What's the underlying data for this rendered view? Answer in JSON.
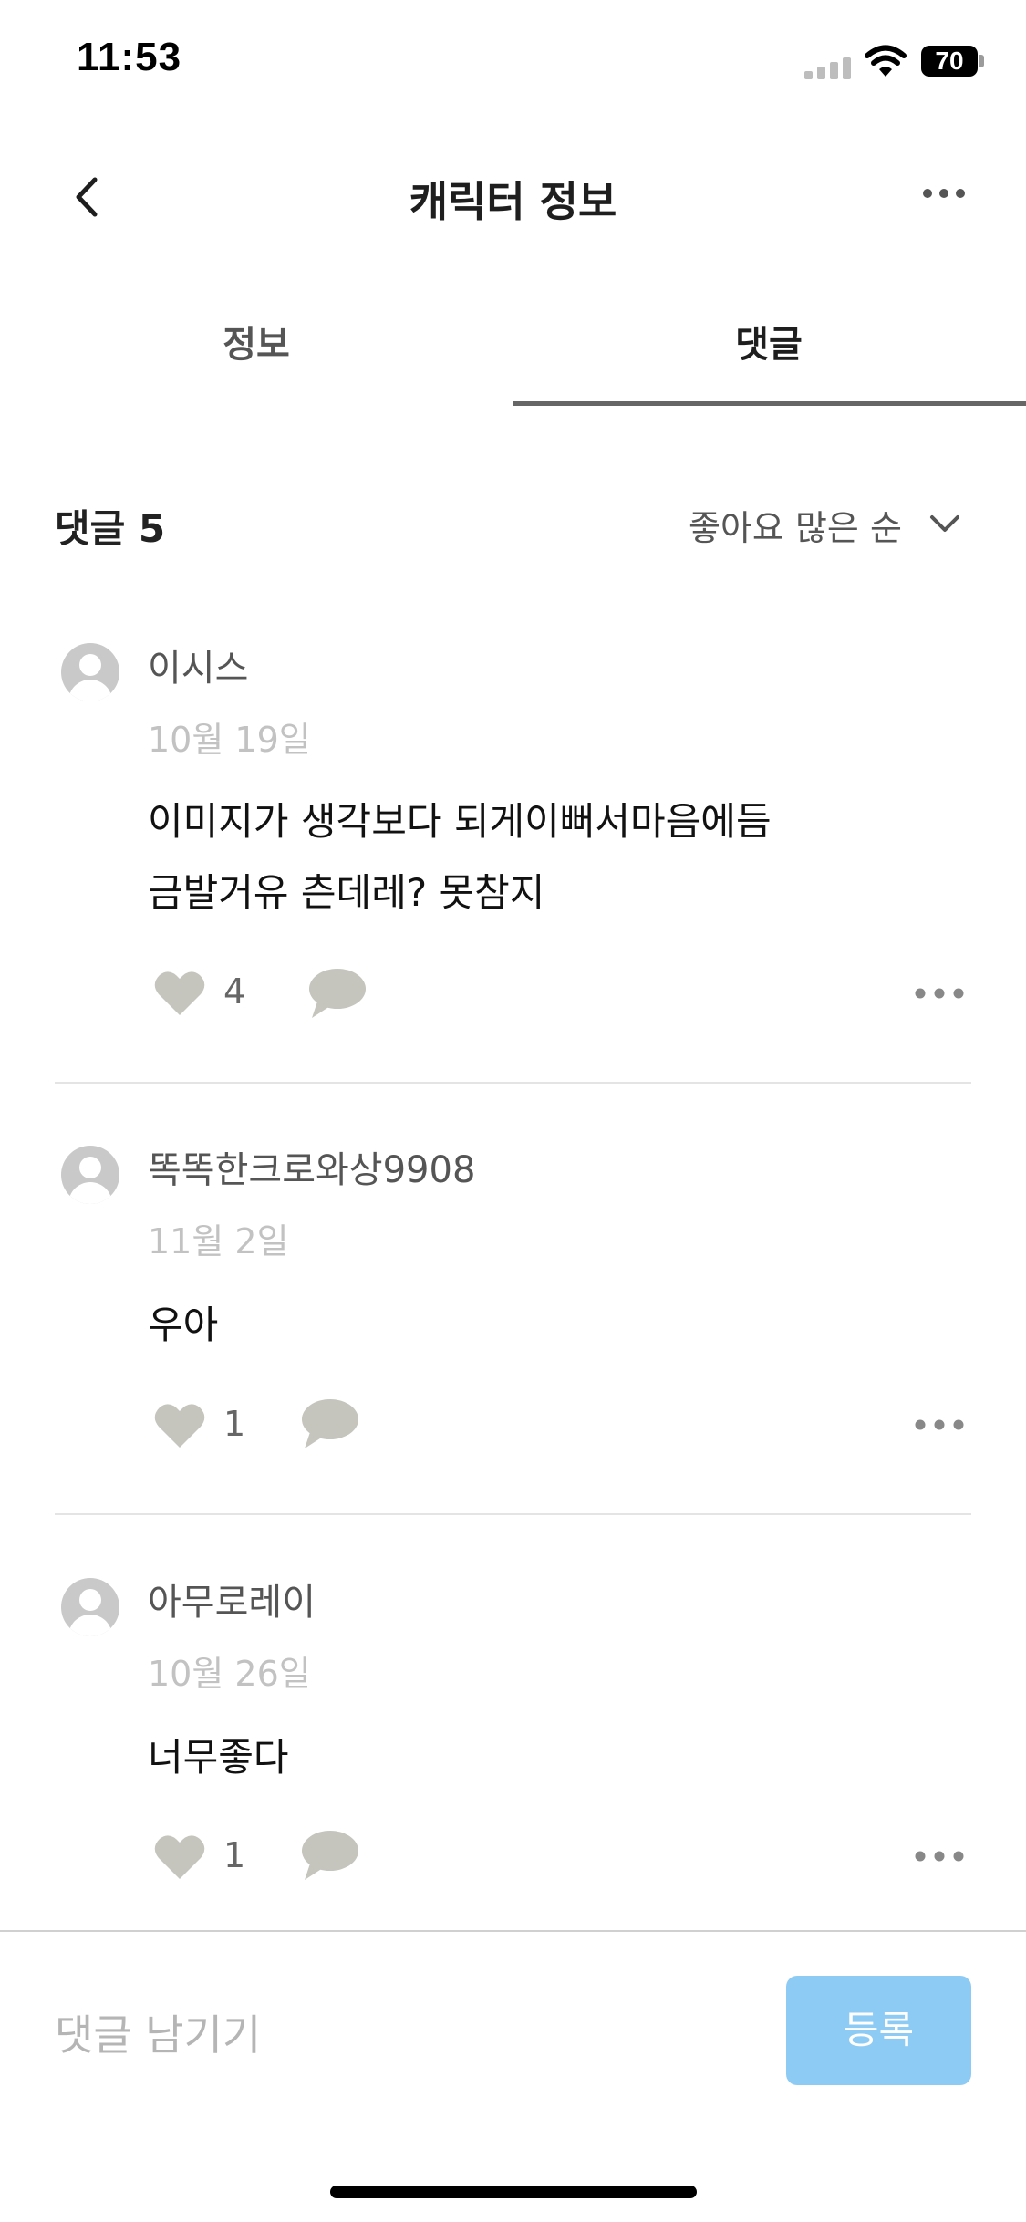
{
  "status_bar": {
    "time": "11:53",
    "battery": "70"
  },
  "header": {
    "title": "캐릭터 정보"
  },
  "tabs": [
    {
      "label": "정보",
      "active": false
    },
    {
      "label": "댓글",
      "active": true
    }
  ],
  "comments_header": {
    "count_label": "댓글 5",
    "sort_label": "좋아요 많은 순"
  },
  "comments": [
    {
      "username": "이시스",
      "date": "10월 19일",
      "lines": [
        "이미지가 생각보다 되게이뻐서마음에듬",
        "금발거유 츤데레? 못참지"
      ],
      "likes": "4"
    },
    {
      "username": "똑똑한크로와상9908",
      "date": "11월 2일",
      "lines": [
        "우아"
      ],
      "likes": "1"
    },
    {
      "username": "아무로레이",
      "date": "10월 26일",
      "lines": [
        "너무좋다"
      ],
      "likes": "1"
    }
  ],
  "input": {
    "placeholder": "댓글 남기기",
    "submit_label": "등록"
  },
  "colors": {
    "submit_button": "#8ecbf4",
    "icon_gray": "#c5c5bd",
    "active_tab_underline": "#666666"
  },
  "icons": [
    "back-chevron-icon",
    "more-icon",
    "chevron-down-icon",
    "heart-icon",
    "comment-bubble-icon",
    "avatar-icon",
    "wifi-icon",
    "signal-icon",
    "battery-icon"
  ]
}
